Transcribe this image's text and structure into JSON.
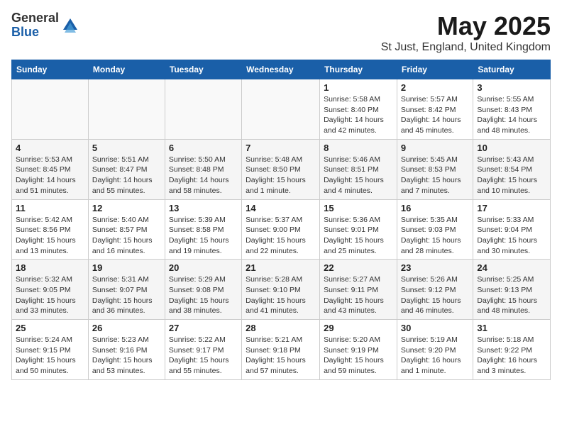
{
  "logo": {
    "general": "General",
    "blue": "Blue"
  },
  "title": "May 2025",
  "location": "St Just, England, United Kingdom",
  "days_header": [
    "Sunday",
    "Monday",
    "Tuesday",
    "Wednesday",
    "Thursday",
    "Friday",
    "Saturday"
  ],
  "weeks": [
    [
      {
        "day": "",
        "info": ""
      },
      {
        "day": "",
        "info": ""
      },
      {
        "day": "",
        "info": ""
      },
      {
        "day": "",
        "info": ""
      },
      {
        "day": "1",
        "info": "Sunrise: 5:58 AM\nSunset: 8:40 PM\nDaylight: 14 hours\nand 42 minutes."
      },
      {
        "day": "2",
        "info": "Sunrise: 5:57 AM\nSunset: 8:42 PM\nDaylight: 14 hours\nand 45 minutes."
      },
      {
        "day": "3",
        "info": "Sunrise: 5:55 AM\nSunset: 8:43 PM\nDaylight: 14 hours\nand 48 minutes."
      }
    ],
    [
      {
        "day": "4",
        "info": "Sunrise: 5:53 AM\nSunset: 8:45 PM\nDaylight: 14 hours\nand 51 minutes."
      },
      {
        "day": "5",
        "info": "Sunrise: 5:51 AM\nSunset: 8:47 PM\nDaylight: 14 hours\nand 55 minutes."
      },
      {
        "day": "6",
        "info": "Sunrise: 5:50 AM\nSunset: 8:48 PM\nDaylight: 14 hours\nand 58 minutes."
      },
      {
        "day": "7",
        "info": "Sunrise: 5:48 AM\nSunset: 8:50 PM\nDaylight: 15 hours\nand 1 minute."
      },
      {
        "day": "8",
        "info": "Sunrise: 5:46 AM\nSunset: 8:51 PM\nDaylight: 15 hours\nand 4 minutes."
      },
      {
        "day": "9",
        "info": "Sunrise: 5:45 AM\nSunset: 8:53 PM\nDaylight: 15 hours\nand 7 minutes."
      },
      {
        "day": "10",
        "info": "Sunrise: 5:43 AM\nSunset: 8:54 PM\nDaylight: 15 hours\nand 10 minutes."
      }
    ],
    [
      {
        "day": "11",
        "info": "Sunrise: 5:42 AM\nSunset: 8:56 PM\nDaylight: 15 hours\nand 13 minutes."
      },
      {
        "day": "12",
        "info": "Sunrise: 5:40 AM\nSunset: 8:57 PM\nDaylight: 15 hours\nand 16 minutes."
      },
      {
        "day": "13",
        "info": "Sunrise: 5:39 AM\nSunset: 8:58 PM\nDaylight: 15 hours\nand 19 minutes."
      },
      {
        "day": "14",
        "info": "Sunrise: 5:37 AM\nSunset: 9:00 PM\nDaylight: 15 hours\nand 22 minutes."
      },
      {
        "day": "15",
        "info": "Sunrise: 5:36 AM\nSunset: 9:01 PM\nDaylight: 15 hours\nand 25 minutes."
      },
      {
        "day": "16",
        "info": "Sunrise: 5:35 AM\nSunset: 9:03 PM\nDaylight: 15 hours\nand 28 minutes."
      },
      {
        "day": "17",
        "info": "Sunrise: 5:33 AM\nSunset: 9:04 PM\nDaylight: 15 hours\nand 30 minutes."
      }
    ],
    [
      {
        "day": "18",
        "info": "Sunrise: 5:32 AM\nSunset: 9:05 PM\nDaylight: 15 hours\nand 33 minutes."
      },
      {
        "day": "19",
        "info": "Sunrise: 5:31 AM\nSunset: 9:07 PM\nDaylight: 15 hours\nand 36 minutes."
      },
      {
        "day": "20",
        "info": "Sunrise: 5:29 AM\nSunset: 9:08 PM\nDaylight: 15 hours\nand 38 minutes."
      },
      {
        "day": "21",
        "info": "Sunrise: 5:28 AM\nSunset: 9:10 PM\nDaylight: 15 hours\nand 41 minutes."
      },
      {
        "day": "22",
        "info": "Sunrise: 5:27 AM\nSunset: 9:11 PM\nDaylight: 15 hours\nand 43 minutes."
      },
      {
        "day": "23",
        "info": "Sunrise: 5:26 AM\nSunset: 9:12 PM\nDaylight: 15 hours\nand 46 minutes."
      },
      {
        "day": "24",
        "info": "Sunrise: 5:25 AM\nSunset: 9:13 PM\nDaylight: 15 hours\nand 48 minutes."
      }
    ],
    [
      {
        "day": "25",
        "info": "Sunrise: 5:24 AM\nSunset: 9:15 PM\nDaylight: 15 hours\nand 50 minutes."
      },
      {
        "day": "26",
        "info": "Sunrise: 5:23 AM\nSunset: 9:16 PM\nDaylight: 15 hours\nand 53 minutes."
      },
      {
        "day": "27",
        "info": "Sunrise: 5:22 AM\nSunset: 9:17 PM\nDaylight: 15 hours\nand 55 minutes."
      },
      {
        "day": "28",
        "info": "Sunrise: 5:21 AM\nSunset: 9:18 PM\nDaylight: 15 hours\nand 57 minutes."
      },
      {
        "day": "29",
        "info": "Sunrise: 5:20 AM\nSunset: 9:19 PM\nDaylight: 15 hours\nand 59 minutes."
      },
      {
        "day": "30",
        "info": "Sunrise: 5:19 AM\nSunset: 9:20 PM\nDaylight: 16 hours\nand 1 minute."
      },
      {
        "day": "31",
        "info": "Sunrise: 5:18 AM\nSunset: 9:22 PM\nDaylight: 16 hours\nand 3 minutes."
      }
    ]
  ]
}
